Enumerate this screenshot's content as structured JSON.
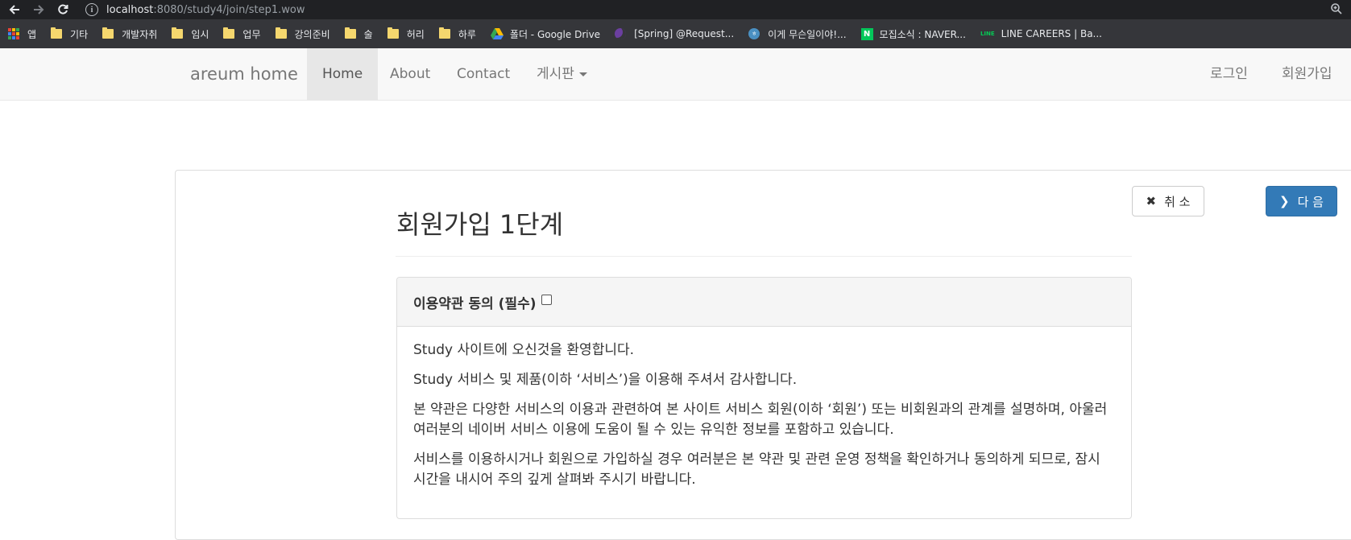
{
  "browser": {
    "url_host": "localhost",
    "url_path": ":8080/study4/join/step1.wow",
    "bookmarks": [
      {
        "label": "앱",
        "icon": "apps-grid-icon"
      },
      {
        "label": "기타",
        "icon": "folder-icon"
      },
      {
        "label": "개발자취",
        "icon": "folder-icon"
      },
      {
        "label": "임시",
        "icon": "folder-icon"
      },
      {
        "label": "업무",
        "icon": "folder-icon"
      },
      {
        "label": "강의준비",
        "icon": "folder-icon"
      },
      {
        "label": "술",
        "icon": "folder-icon"
      },
      {
        "label": "허리",
        "icon": "folder-icon"
      },
      {
        "label": "하루",
        "icon": "folder-icon"
      },
      {
        "label": "폴더 - Google Drive",
        "icon": "google-drive-icon"
      },
      {
        "label": "[Spring] @Request...",
        "icon": "moon-icon"
      },
      {
        "label": "이게 무슨일이야!...",
        "icon": "site-icon"
      },
      {
        "label": "모집소식 : NAVER...",
        "icon": "naver-icon"
      },
      {
        "label": "LINE CAREERS | Ba...",
        "icon": "line-icon"
      }
    ],
    "site_icon_text": "ㅎ"
  },
  "navbar": {
    "brand": "areum home",
    "items": [
      "Home",
      "About",
      "Contact",
      "게시판"
    ],
    "right_items": [
      "로그인",
      "회원가입"
    ]
  },
  "actions": {
    "cancel_label": "취 소",
    "cancel_icon": "✖",
    "next_label": "다 음",
    "next_icon": "❯"
  },
  "page": {
    "title": "회원가입 1단계"
  },
  "terms": {
    "heading": "이용약관 동의 (필수)",
    "agree_checked": false,
    "paragraphs": [
      "Study 사이트에 오신것을 환영합니다.",
      "Study 서비스 및 제품(이하 ‘서비스’)을 이용해 주셔서 감사합니다.",
      "본 약관은 다양한 서비스의 이용과 관련하여 본 사이트 서비스 회원(이하 ‘회원’) 또는 비회원과의 관계를 설명하며, 아울러 여러분의 네이버 서비스 이용에 도움이 될 수 있는 유익한 정보를 포함하고 있습니다.",
      "서비스를 이용하시거나 회원으로 가입하실 경우 여러분은 본 약관 및 관련 운영 정책을 확인하거나 동의하게 되므로, 잠시 시간을 내시어 주의 깊게 살펴봐 주시기 바랍니다."
    ]
  },
  "colors": {
    "primary": "#337ab7",
    "navbar_bg": "#f8f8f8",
    "chrome_bg": "#202124",
    "bookmarks_bg": "#35363a"
  }
}
